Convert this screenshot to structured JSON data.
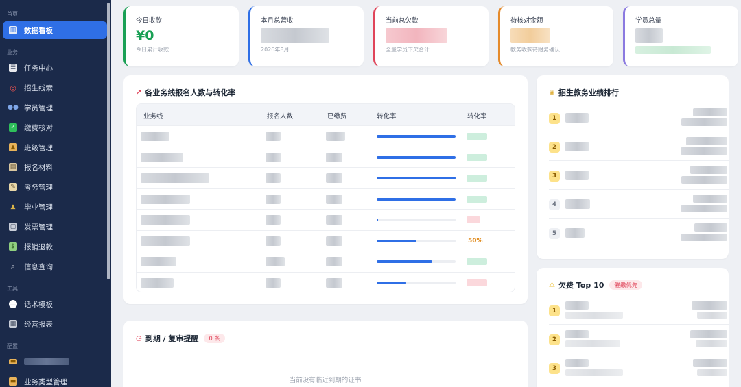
{
  "sidebar": {
    "sections": {
      "home": "首页",
      "business": "业务",
      "tools": "工具",
      "config": "配置"
    },
    "items": [
      {
        "label": "数据看板",
        "icon": "dashboard-icon",
        "glyph": "▥",
        "color": "#6ea8ff"
      },
      {
        "label": "任务中心",
        "icon": "task-icon",
        "glyph": "☰",
        "color": "#e7e9ee"
      },
      {
        "label": "招生线索",
        "icon": "target-icon",
        "glyph": "◎",
        "color": "#ef5350"
      },
      {
        "label": "学员管理",
        "icon": "users-icon",
        "glyph": "●",
        "color": "#7fa7e8"
      },
      {
        "label": "缴费核对",
        "icon": "check-icon",
        "glyph": "✓",
        "color": "#2fbf5b"
      },
      {
        "label": "班级管理",
        "icon": "school-icon",
        "glyph": "▲",
        "color": "#e8b35a"
      },
      {
        "label": "报名材料",
        "icon": "clipboard-icon",
        "glyph": "▤",
        "color": "#d9c7a0"
      },
      {
        "label": "考务管理",
        "icon": "memo-icon",
        "glyph": "✎",
        "color": "#e8d7a8"
      },
      {
        "label": "毕业管理",
        "icon": "graduation-cap-icon",
        "glyph": "▲",
        "color": "#3a3a3a"
      },
      {
        "label": "发票管理",
        "icon": "invoice-icon",
        "glyph": "▢",
        "color": "#c8cdd8"
      },
      {
        "label": "报销退款",
        "icon": "money-icon",
        "glyph": "$",
        "color": "#8fcf7f"
      },
      {
        "label": "信息查询",
        "icon": "magnifier-icon",
        "glyph": "⌕",
        "color": "#c8cdd8"
      },
      {
        "label": "话术模板",
        "icon": "speech-bubble-icon",
        "glyph": "◉",
        "color": "#ffffff"
      },
      {
        "label": "经营报表",
        "icon": "report-icon",
        "glyph": "▦",
        "color": "#c8cdd8"
      },
      {
        "label": "业务类型管理",
        "icon": "folder-icon",
        "glyph": "▬",
        "color": "#e8b35a"
      }
    ]
  },
  "stats": [
    {
      "label": "今日收款",
      "value": "¥0",
      "sub": "今日累计收款",
      "color": "#1aa055"
    },
    {
      "label": "本月总营收",
      "value": "",
      "sub": "2026年8月",
      "color": "#2f6fe6"
    },
    {
      "label": "当前总欠款",
      "value": "",
      "sub": "全量学员下欠合计",
      "color": "#e0455a"
    },
    {
      "label": "待核对金额",
      "value": "",
      "sub": "教务收款待财务确认",
      "color": "#e58a2a"
    },
    {
      "label": "学员总量",
      "value": "",
      "sub": "",
      "color": "#8b7ae0"
    }
  ],
  "enroll_panel": {
    "title": "各业务线报名人数与转化率",
    "icon": "chart-up-icon",
    "columns": [
      "业务线",
      "报名人数",
      "已缴费",
      "转化率",
      "转化率"
    ],
    "rows": [
      {
        "fill": 1.0,
        "rate": ""
      },
      {
        "fill": 1.0,
        "rate": ""
      },
      {
        "fill": 1.0,
        "rate": ""
      },
      {
        "fill": 1.0,
        "rate": ""
      },
      {
        "fill": 0.02,
        "rate": ""
      },
      {
        "fill": 0.5,
        "rate": "50%"
      },
      {
        "fill": 0.7,
        "rate": ""
      },
      {
        "fill": 0.37,
        "rate": ""
      }
    ]
  },
  "ranking_panel": {
    "title": "招生教务业绩排行",
    "icon": "trophy-icon",
    "ranks": [
      "1",
      "2",
      "3",
      "4",
      "5"
    ]
  },
  "arrears_panel": {
    "title": "欠费 Top 10",
    "icon": "warning-icon",
    "tag": "催缴优先",
    "ranks": [
      "1",
      "2",
      "3"
    ]
  },
  "reminder_panel": {
    "title": "到期 / 复审提醒",
    "icon": "alarm-clock-icon",
    "tag": "0 条",
    "empty_text": "当前没有临近到期的证书"
  }
}
